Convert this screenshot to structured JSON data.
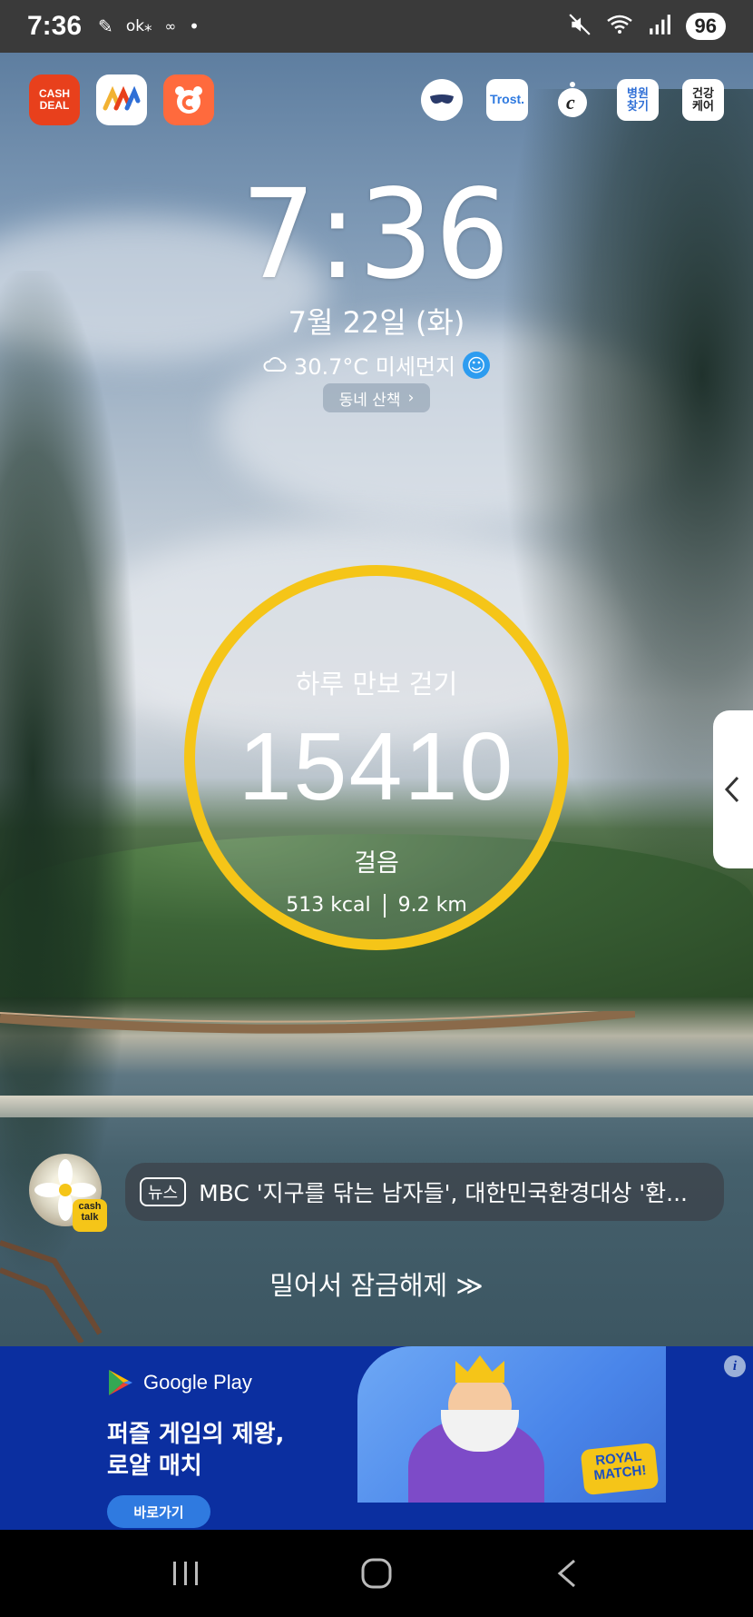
{
  "status_bar": {
    "time": "7:36",
    "left_icons": [
      "pen-icon",
      "ok-icon",
      "ok-icon-2",
      "notification-dot"
    ],
    "right_icons": [
      "mute-icon",
      "wifi-5g-icon",
      "signal-icon"
    ],
    "battery": "96"
  },
  "shortcuts": {
    "left_apps": [
      {
        "name": "cashdeal",
        "label": "CASH\nDEAL",
        "color": "#e8401c"
      },
      {
        "name": "wave-app",
        "label": "",
        "color": "#ffffff"
      },
      {
        "name": "cat-app",
        "label": "",
        "color": "#ff6a3d"
      }
    ],
    "right_apps": [
      {
        "name": "mask-app",
        "label": ""
      },
      {
        "name": "trost",
        "label": "Trost."
      },
      {
        "name": "chat-app",
        "label": "C"
      },
      {
        "name": "hospital",
        "label": "병원\n찾기"
      },
      {
        "name": "health",
        "label": "건강\n케어"
      }
    ]
  },
  "clock": {
    "time": "7:36",
    "date": "7월 22일 (화)",
    "weather": "30.7°C 미세먼지",
    "walk_chip": "동네 산책"
  },
  "steps": {
    "title": "하루 만보 걷기",
    "count": "15410",
    "unit": "걸음",
    "kcal": "513 kcal",
    "distance": "9.2 km",
    "ring_color": "#f5c518"
  },
  "news": {
    "tag": "뉴스",
    "headline": "MBC '지구를 닦는 남자들', 대한민국환경대상 '환...",
    "avatar_badge": "cash\ntalk"
  },
  "unlock_text": "밀어서 잠금해제 ≫",
  "ad": {
    "brand": "Google Play",
    "headline_line1": "퍼즐 게임의 제왕,",
    "headline_line2": "로얄 매치",
    "cta": "바로가기",
    "logo_text": "ROYAL MATCH!",
    "info": "i"
  },
  "nav": {
    "recent": "recent-apps",
    "home": "home",
    "back": "back"
  }
}
